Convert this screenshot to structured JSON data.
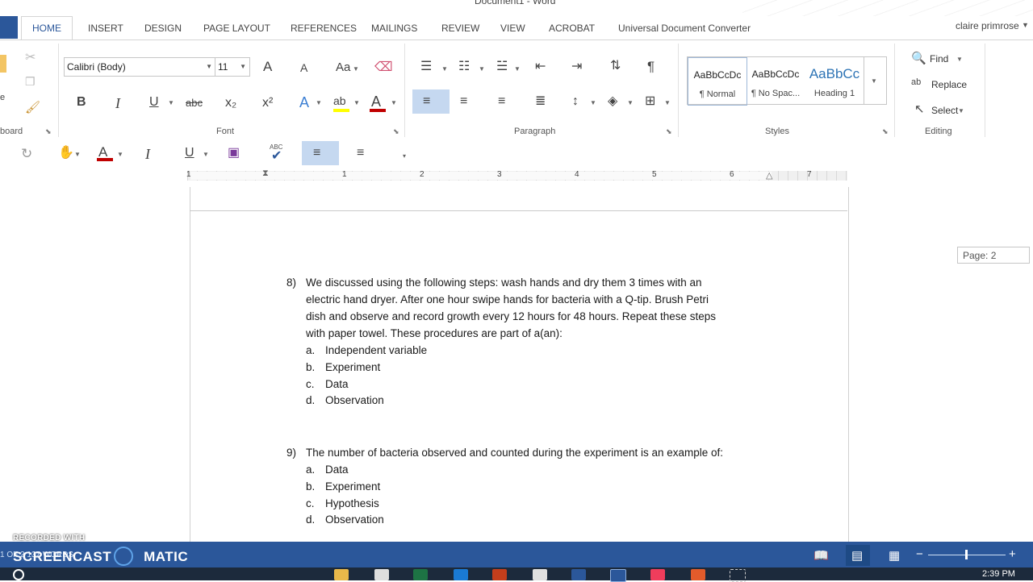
{
  "window": {
    "title": "Document1 - Word",
    "user": "claire primrose"
  },
  "tabs": [
    {
      "label": "HOME",
      "active": true
    },
    {
      "label": "INSERT"
    },
    {
      "label": "DESIGN"
    },
    {
      "label": "PAGE LAYOUT"
    },
    {
      "label": "REFERENCES"
    },
    {
      "label": "MAILINGS"
    },
    {
      "label": "REVIEW"
    },
    {
      "label": "VIEW"
    },
    {
      "label": "ACROBAT"
    },
    {
      "label": "Universal Document Converter"
    }
  ],
  "ribbon": {
    "clipboard": {
      "label": "board",
      "paste_fragment": "e"
    },
    "font": {
      "label": "Font",
      "font_name": "Calibri (Body)",
      "font_size": "11",
      "grow": "A",
      "shrink": "A",
      "case": "Aa",
      "bold": "B",
      "italic": "I",
      "underline": "U",
      "strike": "abc",
      "subscript": "x₂",
      "superscript": "x²",
      "text_effect": "A",
      "highlight": "ab",
      "font_color": "A"
    },
    "paragraph": {
      "label": "Paragraph",
      "show_marks": "¶"
    },
    "styles": {
      "label": "Styles",
      "items": [
        {
          "sample": "AaBbCcDc",
          "name": "¶ Normal"
        },
        {
          "sample": "AaBbCcDc",
          "name": "¶ No Spac..."
        },
        {
          "sample": "AaBbCc",
          "name": "Heading 1"
        }
      ]
    },
    "editing": {
      "label": "Editing",
      "find": "Find",
      "replace": "Replace",
      "select": "Select"
    }
  },
  "qat": {
    "spell_label": "ABC"
  },
  "ruler": {
    "numbers": [
      "1",
      "1",
      "2",
      "3",
      "4",
      "5",
      "6",
      "7"
    ]
  },
  "page_indicator": "Page: 2",
  "document": {
    "questions": [
      {
        "number": "8)",
        "lines": [
          "We discussed using the following steps:  wash hands and dry them 3 times with an",
          "electric hand dryer.  After one hour swipe hands for bacteria with a Q-tip.   Brush Petri",
          "dish and observe and record growth every 12 hours for 48 hours.    Repeat these steps",
          "with paper towel.  These procedures are part of a(an):"
        ],
        "options": [
          {
            "letter": "a.",
            "text": "Independent variable"
          },
          {
            "letter": "b.",
            "text": "Experiment"
          },
          {
            "letter": "c.",
            "text": "Data"
          },
          {
            "letter": "d.",
            "text": "Observation"
          }
        ]
      },
      {
        "number": "9)",
        "lines": [
          "The number of bacteria observed and counted during the experiment is an example of:"
        ],
        "options": [
          {
            "letter": "a.",
            "text": "Data"
          },
          {
            "letter": "b.",
            "text": "Experiment"
          },
          {
            "letter": "c.",
            "text": "Hypothesis"
          },
          {
            "letter": "d.",
            "text": "Observation"
          }
        ]
      }
    ]
  },
  "status": {
    "left_fragment": "1 OF 2    137 WORDS",
    "watermark_small": "RECORDED WITH",
    "watermark_left": "SCREENCAST",
    "watermark_right": "MATIC",
    "zoom_minus": "−",
    "zoom_plus": "+"
  },
  "taskbar": {
    "clock": "2:39 PM"
  },
  "colors": {
    "accent": "#2b579a",
    "font_color_bar": "#c00000",
    "highlight_bar": "#ffff00"
  }
}
